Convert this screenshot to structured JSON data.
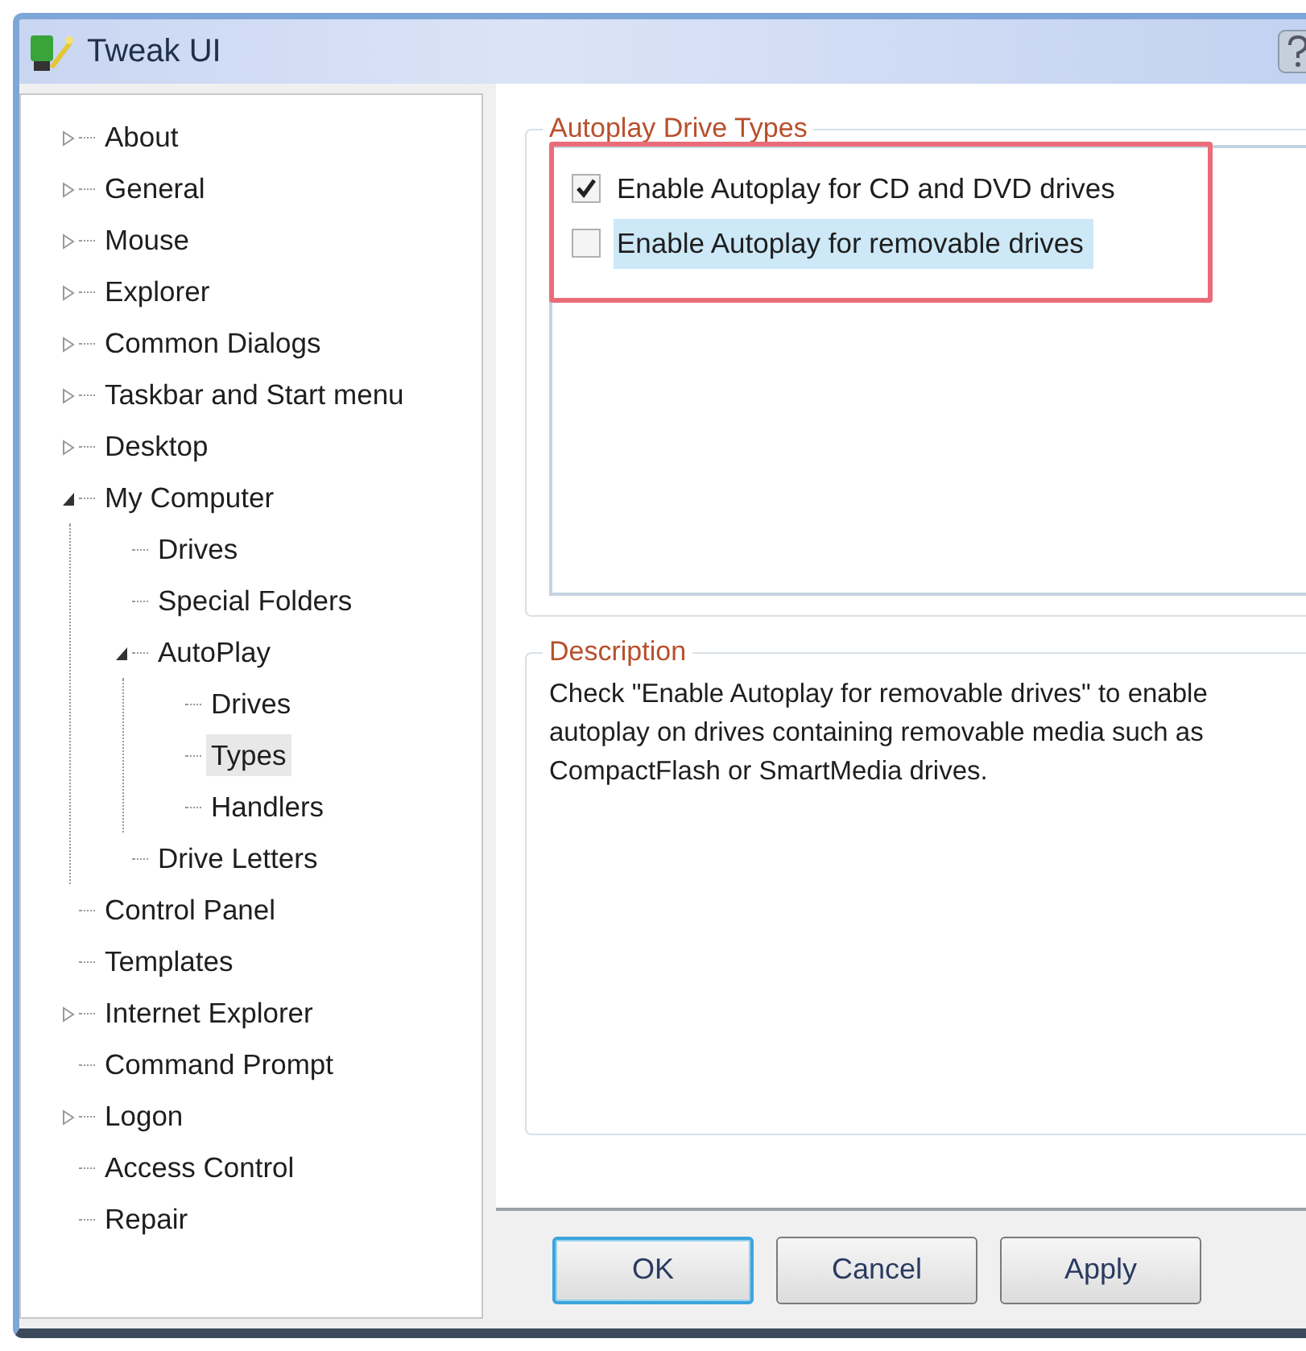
{
  "window": {
    "title": "Tweak UI"
  },
  "tree": [
    {
      "label": "About",
      "expanded": false,
      "selected": false
    },
    {
      "label": "General",
      "expanded": false,
      "selected": false
    },
    {
      "label": "Mouse",
      "expanded": false,
      "selected": false
    },
    {
      "label": "Explorer",
      "expanded": false,
      "selected": false
    },
    {
      "label": "Common Dialogs",
      "expanded": false,
      "selected": false
    },
    {
      "label": "Taskbar and Start menu",
      "expanded": false,
      "selected": false
    },
    {
      "label": "Desktop",
      "expanded": false,
      "selected": false
    },
    {
      "label": "My Computer",
      "expanded": true,
      "selected": false,
      "children": [
        {
          "label": "Drives",
          "selected": false
        },
        {
          "label": "Special Folders",
          "selected": false
        },
        {
          "label": "AutoPlay",
          "expanded": true,
          "selected": false,
          "children": [
            {
              "label": "Drives",
              "selected": false
            },
            {
              "label": "Types",
              "selected": true
            },
            {
              "label": "Handlers",
              "selected": false
            }
          ]
        },
        {
          "label": "Drive Letters",
          "selected": false
        }
      ]
    },
    {
      "label": "Control Panel",
      "selected": false
    },
    {
      "label": "Templates",
      "selected": false
    },
    {
      "label": "Internet Explorer",
      "expanded": false,
      "selected": false
    },
    {
      "label": "Command Prompt",
      "selected": false
    },
    {
      "label": "Logon",
      "expanded": false,
      "selected": false
    },
    {
      "label": "Access Control",
      "selected": false
    },
    {
      "label": "Repair",
      "selected": false
    }
  ],
  "autoplay_group": {
    "title": "Autoplay Drive Types",
    "options": [
      {
        "label": "Enable Autoplay for CD and DVD drives",
        "checked": true,
        "selected": false
      },
      {
        "label": "Enable Autoplay for removable drives",
        "checked": false,
        "selected": true
      }
    ]
  },
  "description_group": {
    "title": "Description",
    "text": "Check \"Enable Autoplay for removable drives\" to enable autoplay on drives containing removable media such as CompactFlash or SmartMedia drives."
  },
  "buttons": [
    {
      "label": "OK",
      "default": true
    },
    {
      "label": "Cancel",
      "default": false
    },
    {
      "label": "Apply",
      "default": false
    }
  ]
}
